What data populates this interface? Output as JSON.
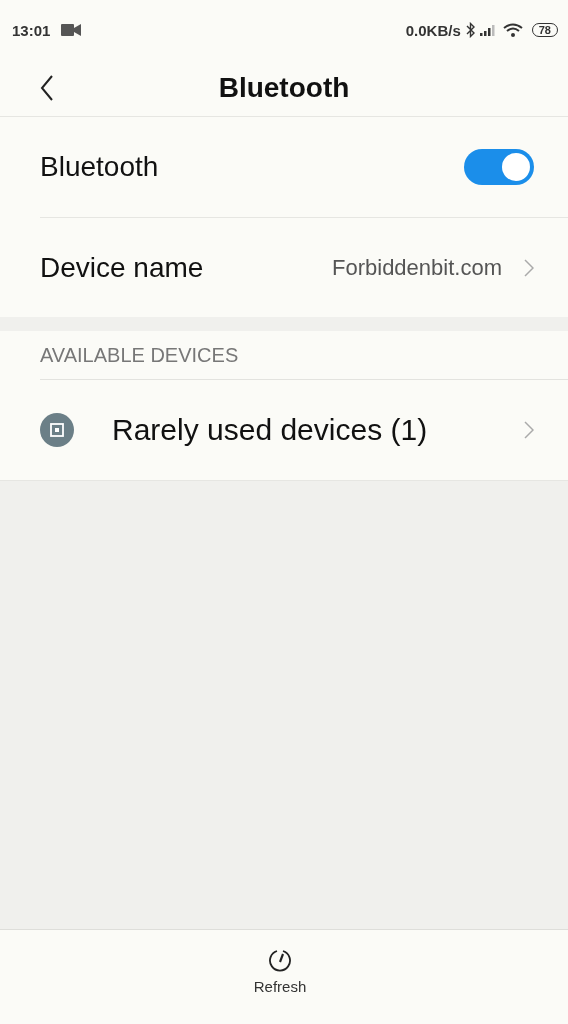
{
  "status_bar": {
    "time": "13:01",
    "speed": "0.0KB/s",
    "battery": "78"
  },
  "header": {
    "title": "Bluetooth"
  },
  "settings": [
    {
      "kind": "toggle",
      "label": "Bluetooth",
      "on": true
    },
    {
      "kind": "link",
      "label": "Device name",
      "value": "Forbiddenbit.com"
    }
  ],
  "available_devices": {
    "heading": "AVAILABLE DEVICES",
    "items": [
      {
        "label": "Rarely used devices (1)"
      }
    ]
  },
  "bottom_bar": {
    "action": "Refresh"
  }
}
